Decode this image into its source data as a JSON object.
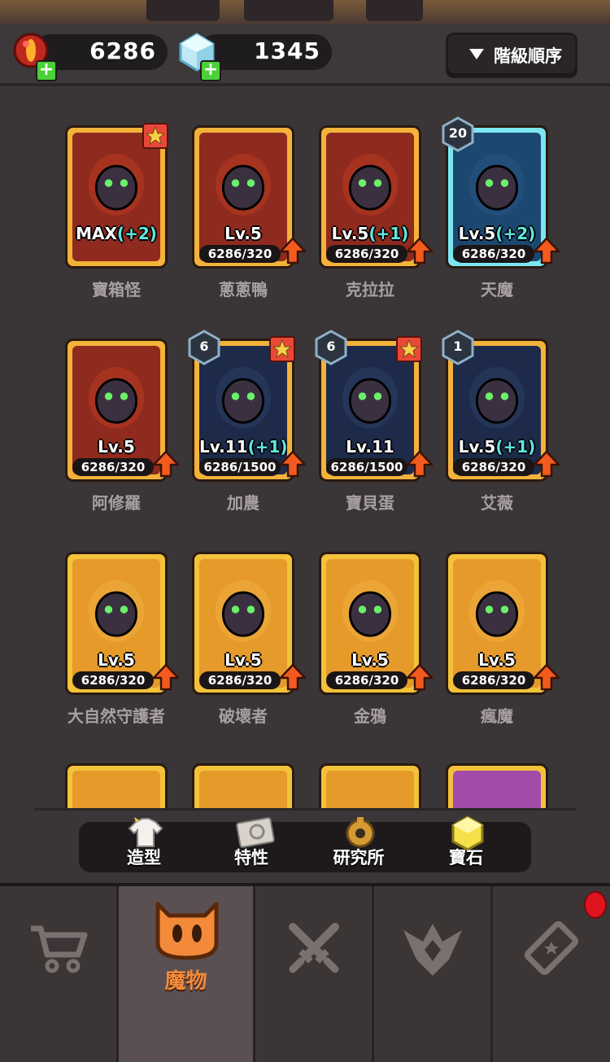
{
  "resources": {
    "meat": {
      "value": "6286",
      "icon": "meat-orb-icon"
    },
    "gem": {
      "value": "1345",
      "icon": "crystal-gem-icon"
    }
  },
  "sort_button": {
    "label": "階級順序"
  },
  "monsters": [
    {
      "name": "寶箱怪",
      "level": "MAX",
      "bonus": "(+2)",
      "progress": "",
      "frame": "red",
      "star": true,
      "badge": "",
      "upgrade": false
    },
    {
      "name": "蔥蔥鴨",
      "level": "Lv.5",
      "bonus": "",
      "progress": "6286/320",
      "frame": "red",
      "star": false,
      "badge": "",
      "upgrade": true
    },
    {
      "name": "克拉拉",
      "level": "Lv.5",
      "bonus": "(+1)",
      "progress": "6286/320",
      "frame": "red",
      "star": false,
      "badge": "",
      "upgrade": true
    },
    {
      "name": "天魔",
      "level": "Lv.5",
      "bonus": "(+2)",
      "progress": "6286/320",
      "frame": "blue",
      "star": false,
      "badge": "20",
      "upgrade": true
    },
    {
      "name": "阿修羅",
      "level": "Lv.5",
      "bonus": "",
      "progress": "6286/320",
      "frame": "red",
      "star": false,
      "badge": "",
      "upgrade": true
    },
    {
      "name": "加農",
      "level": "Lv.11",
      "bonus": "(+1)",
      "progress": "6286/1500",
      "frame": "dark",
      "star": true,
      "badge": "6",
      "upgrade": true
    },
    {
      "name": "寶貝蛋",
      "level": "Lv.11",
      "bonus": "",
      "progress": "6286/1500",
      "frame": "dark",
      "star": true,
      "badge": "6",
      "upgrade": true
    },
    {
      "name": "艾薇",
      "level": "Lv.5",
      "bonus": "(+1)",
      "progress": "6286/320",
      "frame": "dark",
      "star": false,
      "badge": "1",
      "upgrade": true
    },
    {
      "name": "大自然守護者",
      "level": "Lv.5",
      "bonus": "",
      "progress": "6286/320",
      "frame": "gold",
      "star": false,
      "badge": "",
      "upgrade": true
    },
    {
      "name": "破壞者",
      "level": "Lv.5",
      "bonus": "",
      "progress": "6286/320",
      "frame": "gold",
      "star": false,
      "badge": "",
      "upgrade": true
    },
    {
      "name": "金鴉",
      "level": "Lv.5",
      "bonus": "",
      "progress": "6286/320",
      "frame": "gold",
      "star": false,
      "badge": "",
      "upgrade": true
    },
    {
      "name": "瘋魔",
      "level": "Lv.5",
      "bonus": "",
      "progress": "6286/320",
      "frame": "gold",
      "star": false,
      "badge": "",
      "upgrade": true
    }
  ],
  "subnav": [
    {
      "label": "造型",
      "icon": "tshirt-icon"
    },
    {
      "label": "特性",
      "icon": "scroll-icon"
    },
    {
      "label": "研究所",
      "icon": "gear-icon"
    },
    {
      "label": "寶石",
      "icon": "gem-icon"
    }
  ],
  "tabs": [
    {
      "icon": "cart-icon",
      "label": ""
    },
    {
      "icon": "monster-face-icon",
      "label": "魔物"
    },
    {
      "icon": "crossed-swords-icon",
      "label": ""
    },
    {
      "icon": "rank-wings-icon",
      "label": ""
    },
    {
      "icon": "ticket-icon",
      "label": ""
    }
  ],
  "colors": {
    "accent": "#f38a3a",
    "red_frame": "#8e2a1e",
    "blue_frame": "#1b4870",
    "gold_frame": "#e59a2a",
    "bonus_text": "#5fe8e0"
  }
}
